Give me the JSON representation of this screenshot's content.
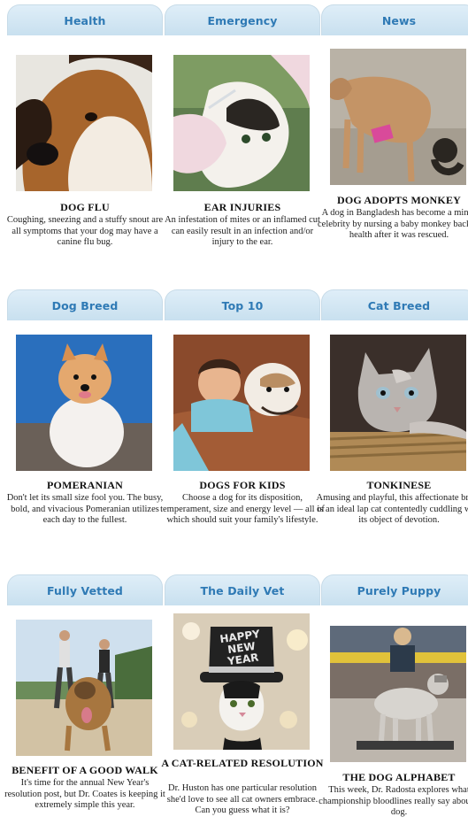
{
  "cards": [
    {
      "tab": "Health",
      "title": "DOG FLU",
      "desc": "Coughing, sneezing and a stuffy snout are all symptoms that your dog may have a canine flu bug.",
      "image_icon": "dog-face-photo"
    },
    {
      "tab": "Emergency",
      "title": "EAR INJURIES",
      "desc": "An infestation of mites or an inflamed cut can easily result in an infection and/or injury to the ear.",
      "image_icon": "cat-ear-exam-photo"
    },
    {
      "tab": "News",
      "title": "DOG ADOPTS MONKEY",
      "desc": "A dog in Bangladesh has become a minor celebrity by nursing a baby monkey back to health after it was rescued.",
      "image_icon": "dog-and-monkey-photo"
    },
    {
      "tab": "Dog Breed",
      "title": "POMERANIAN",
      "desc": "Don't let its small size fool you. The busy, bold, and vivacious Pomeranian utilizes each day to the fullest.",
      "image_icon": "pomeranian-photo"
    },
    {
      "tab": "Top 10",
      "title": "DOGS FOR KIDS",
      "desc": "Choose a dog for its disposition, temperament, size and energy level — all of which should suit your family's lifestyle.",
      "image_icon": "boy-with-bulldog-photo"
    },
    {
      "tab": "Cat Breed",
      "title": "TONKINESE",
      "desc": "Amusing and playful, this affectionate breed is an ideal lap cat contentedly cuddling with its object of devotion.",
      "image_icon": "tonkinese-cat-photo"
    },
    {
      "tab": "Fully Vetted",
      "title": "BENEFIT OF A GOOD WALK",
      "desc": "It's time for the annual New Year's resolution post, but Dr. Coates is keeping it extremely simple this year.",
      "image_icon": "dog-walk-photo"
    },
    {
      "tab": "The Daily Vet",
      "title": "A CAT-RELATED RESOLUTION",
      "desc": "Dr. Huston has one particular resolution she'd love to see all cat owners embrace. Can you guess what it is?",
      "image_icon": "new-year-cat-photo",
      "hat_text": "HAPPY NEW YEAR"
    },
    {
      "tab": "Purely Puppy",
      "title": "THE DOG ALPHABET",
      "desc": "This week, Dr. Radosta explores what championship bloodlines really say about a dog.",
      "image_icon": "dog-show-photo"
    }
  ],
  "colors": {
    "tab_text": "#2f7ab5",
    "tab_bg": "#d6e8f4"
  }
}
